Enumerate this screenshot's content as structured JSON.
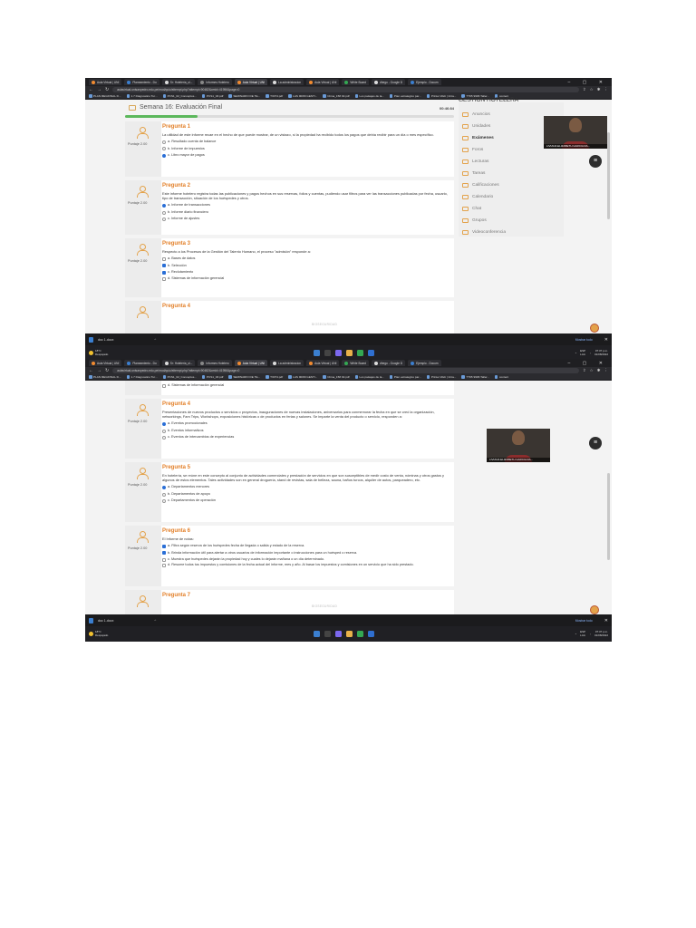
{
  "browser": {
    "tabs": [
      {
        "label": "Aula Virtual | UNI",
        "color": "#f28b30",
        "active": false
      },
      {
        "label": "Planeamiento - Do",
        "color": "#3b7fd0",
        "active": false
      },
      {
        "label": "Sr: Hoteleria_ol...",
        "color": "#dddddd",
        "active": false
      },
      {
        "label": "Informes Hotelero",
        "color": "#888888",
        "active": false
      },
      {
        "label": "Aula Virtual | UNI",
        "color": "#f28b30",
        "active": true
      },
      {
        "label": "La administracion",
        "color": "#dddddd",
        "active": false
      },
      {
        "label": "Aula Virtual | UNI",
        "color": "#f28b30",
        "active": false
      },
      {
        "label": "White Board",
        "color": "#34a853",
        "active": false
      },
      {
        "label": "dhego - Google D",
        "color": "#dddddd",
        "active": false
      },
      {
        "label": "Ejemplo - Docum",
        "color": "#3b7fd0",
        "active": false
      }
    ],
    "url": "aulavirtual.unisanpedro.edu.pe/mod/quiz/attempt.php?attempt=90482&cmid=41956&page=0",
    "bookmarks": [
      "PLAN REGIONAL D...",
      "1.7 Diagnostico Tur...",
      "PCS1_02_Conceptos...",
      "PCS1_03.pdf",
      "SEMINARIO DE TE...",
      "T3074.pdf",
      "LAS 90/80 GESTI...",
      "Clima_158 02.pdf",
      "Los paisajes de la...",
      "Plan estrategico par...",
      "Printer Web | Intra...",
      "TT95 9906 Taller...",
      "content"
    ],
    "window_controls": "– ▢ ✕"
  },
  "quiz": {
    "title": "Semana 16: Evaluación Final",
    "timer": "00:46:84",
    "progress_fraction": 0.22
  },
  "course": {
    "title": "GESTION HOTELERA",
    "menu": [
      "Anuncios",
      "Unidades",
      "Exámenes",
      "Foros",
      "Lecturas",
      "Tareas",
      "Calificaciones",
      "Calendario",
      "Chat",
      "Grupos",
      "Videoconferencia"
    ],
    "active_menu": "Exámenes"
  },
  "video_label": "LIVIANA ELIZABETH GARCIA RA...",
  "footer": "BIOSEGURIDAD",
  "downloads": {
    "file": "doc 1.docx",
    "show_all": "Mostrar todo"
  },
  "taskbar": {
    "temp": "18°C",
    "weather": "Despejado",
    "lang": "ESP\nLAA",
    "time": "07:37 p.m.",
    "date": "01/08/2022"
  },
  "questions": [
    {
      "title": "Pregunta 1",
      "points": "Puntaje 2.00",
      "text": "La utilidad de este informe recae en el hecho de que puede mostrar, de un vistazo, si la propiedad ha recibido todos los pagos que debía recibir para un día o mes específico.",
      "options": [
        {
          "label": "a. Resultado cuenta de balance",
          "selected": false
        },
        {
          "label": "b. Informe de impuestos",
          "selected": false
        },
        {
          "label": "c. Libro mayor de pagos",
          "selected": true
        }
      ]
    },
    {
      "title": "Pregunta 2",
      "points": "Puntaje 2.00",
      "text": "Este informe hotelero registra todas las publicaciones y pagos hechos en sus reservas, folios y cuentas, pudiendo usar filtros para ver las transacciones publicadas por fecha, usuario, tipo de transacción, situación de los huéspedes y otros.",
      "options": [
        {
          "label": "a. Informe de transacciones",
          "selected": true
        },
        {
          "label": "b. Informe diario financiero",
          "selected": false
        },
        {
          "label": "c. Informe de ajustes",
          "selected": false
        }
      ]
    },
    {
      "title": "Pregunta 3",
      "points": "Puntaje 2.00",
      "text": "Respecto a los Procesos de la Gestión del Talento Humano, el proceso \"admisión\" responde a:",
      "options": [
        {
          "label": "a. Bases de datos",
          "selected": false
        },
        {
          "label": "b. Selección",
          "selected": true
        },
        {
          "label": "c. Reclutamiento",
          "selected": true
        },
        {
          "label": "d. Sistemas de información gerencial",
          "selected": false
        }
      ]
    },
    {
      "title": "Pregunta 4",
      "points": "Puntaje 2.00",
      "text": "Presentaciones de nuevos productos o servicios o proyectos, inauguraciones de nuevas instalaciones, aniversarios para conmemorar la fecha en que se creó la organización, networkings, Fam Trips, Workshops, exposiciones históricas o de productos en ferias y salones. Se imparte la venta del producto o servicio, responden a:",
      "options": [
        {
          "label": "a. Eventos promocionales",
          "selected": true
        },
        {
          "label": "b. Eventos informativos",
          "selected": false
        },
        {
          "label": "c. Eventos de intercambios de experiencias",
          "selected": false
        }
      ]
    },
    {
      "title": "Pregunta 5",
      "points": "Puntaje 2.00",
      "text": "En hotelería, se reúne en este concepto al conjunto de actividades comerciales y prestación de servicios en que son susceptibles de medir costo de venta, nóminas y otros gastos y algunos de estos elementos. Tales actividades son en general droguería, stand de revistas, sala de belleza, sauna, baños turcos, alquiler de autos, parqueadero, etc.",
      "options": [
        {
          "label": "a. Departamentos menores",
          "selected": true
        },
        {
          "label": "b. Departamentos de apoyo",
          "selected": false
        },
        {
          "label": "c. Departamentos de operación",
          "selected": false
        }
      ]
    },
    {
      "title": "Pregunta 6",
      "points": "Puntaje 2.00",
      "text": "El Informe de notas:",
      "options": [
        {
          "label": "a. Filtra según reserva de los huéspedes fecha de llegada o salida y estado de la reserva.",
          "selected": true
        },
        {
          "label": "b. Brinda información útil para alertar a otros usuarios de información importante o instrucciones para un huésped o reserva.",
          "selected": true
        },
        {
          "label": "c. Muestra que huéspedes dejarán la propiedad hoy y cuales lo dejarán mañana o un día determinado.",
          "selected": false
        },
        {
          "label": "d. Resume todos tus impuestos y comisiones de la fecha actual del informe, mes y año. Al basar los impuestos y comisiones en un servicio que ha sido prestado.",
          "selected": false
        }
      ]
    },
    {
      "title": "Pregunta 7"
    }
  ]
}
